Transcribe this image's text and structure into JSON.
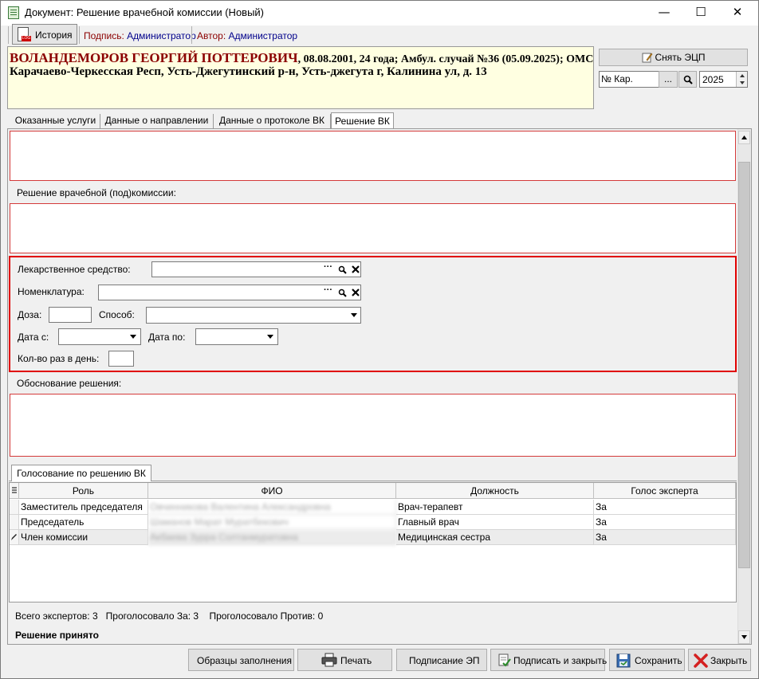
{
  "window": {
    "title": "Документ: Решение врачебной комиссии (Новый)",
    "minimize_glyph": "—",
    "maximize_glyph": "☐",
    "close_glyph": "✕"
  },
  "toolbar": {
    "history_label": "История",
    "history_icon_tag": "LOG",
    "sign_label": "Подпись:",
    "sign_value": "Администратор",
    "author_label": "Автор:",
    "author_value": "Администратор"
  },
  "patient": {
    "name": "ВОЛАНДЕМОРОВ ГЕОРГИЙ ПОТТЕРОВИЧ",
    "details": ", 08.08.2001, 24 года; Амбул. случай №36 (05.09.2025); ОМС",
    "address": "Карачаево-Черкесская Респ, Усть-Джегутинский р-н, Усть-джегута г, Калинина ул, д. 13"
  },
  "right_panel": {
    "ecp_button": "Снять ЭЦП",
    "card_placeholder": "№ Кар.",
    "card_dots": "...",
    "year": "2025"
  },
  "tabs": [
    {
      "label": "Оказанные услуги"
    },
    {
      "label": "Данные о направлении"
    },
    {
      "label": "Данные о протоколе ВК"
    },
    {
      "label": "Решение ВК"
    }
  ],
  "form": {
    "decision_label": "Решение врачебной (под)комиссии:",
    "drug_label": "Лекарственное средство:",
    "nomenclature_label": "Номенклатура:",
    "dose_label": "Доза:",
    "method_label": "Способ:",
    "date_from_label": "Дата с:",
    "date_to_label": "Дата по:",
    "times_per_day_label": "Кол-во раз в день:",
    "justification_label": "Обоснование решения:",
    "lookup_dots": "···"
  },
  "voting": {
    "tab_label": "Голосование по решению ВК",
    "columns": [
      "Роль",
      "ФИО",
      "Должность",
      "Голос эксперта"
    ],
    "rows": [
      {
        "role": "Заместитель председателя",
        "fio": "Овчинникова Валентина Александровна",
        "position": "Врач-терапевт",
        "vote": "За"
      },
      {
        "role": "Председатель",
        "fio": "Шаманов Марат Муратбекович",
        "position": "Главный врач",
        "vote": "За"
      },
      {
        "role": "Член комиссии",
        "fio": "Акбаева Зурра Солтанмуратовна",
        "position": "Медицинская сестра",
        "vote": "За"
      }
    ],
    "summary_total": "Всего экспертов: 3",
    "summary_for": "Проголосовало За: 3",
    "summary_against": "Проголосовало Против: 0",
    "result": "Решение принято"
  },
  "buttons": {
    "templates": "Образцы заполнения",
    "print": "Печать",
    "sign_ep": "Подписание ЭП",
    "sign_close": "Подписать и закрыть",
    "save": "Сохранить",
    "close": "Закрыть"
  }
}
